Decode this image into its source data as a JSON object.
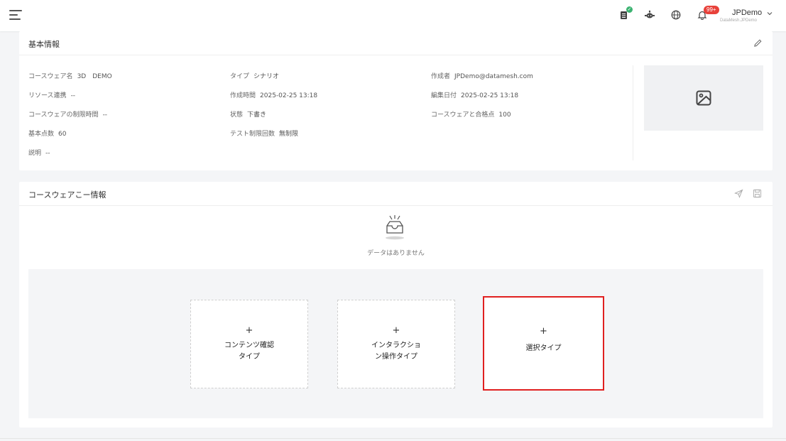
{
  "header": {
    "user_name": "JPDemo",
    "user_sub": "DataMesh.JPDemo",
    "notification_badge": "99+",
    "icons": [
      "menu-icon",
      "clipboard-check-icon",
      "robot-icon",
      "globe-icon",
      "bell-icon",
      "chevron-down-icon"
    ]
  },
  "basic_info": {
    "title": "基本情報",
    "fields": {
      "courseware_name": {
        "label": "コースウェア名",
        "value": "3D　DEMO"
      },
      "resource_link": {
        "label": "リソース連携",
        "value": "--"
      },
      "courseware_limit_time": {
        "label": "コースウェアの制限時間",
        "value": "--"
      },
      "base_score": {
        "label": "基本点数",
        "value": "60"
      },
      "description": {
        "label": "説明",
        "value": "--"
      },
      "type": {
        "label": "タイプ",
        "value": "シナリオ"
      },
      "created_time": {
        "label": "作成時間",
        "value": "2025-02-25 13:18"
      },
      "status": {
        "label": "状態",
        "value": "下書き"
      },
      "test_limit_count": {
        "label": "テスト制限回数",
        "value": "無制限"
      },
      "creator": {
        "label": "作成者",
        "value": "JPDemo@datamesh.com"
      },
      "edited_date": {
        "label": "編集日付",
        "value": "2025-02-25 13:18"
      },
      "pass_score": {
        "label": "コースウェアと合格点",
        "value": "100"
      }
    }
  },
  "courseware_info": {
    "title": "コースウェアこー情報",
    "empty_text": "データはありません",
    "types": [
      {
        "plus": "+",
        "label_line1": "コンテンツ確認",
        "label_line2": "タイプ",
        "selected": false
      },
      {
        "plus": "+",
        "label_line1": "インタラクショ",
        "label_line2": "ン操作タイプ",
        "selected": false
      },
      {
        "plus": "+",
        "label_line1": "選択タイプ",
        "label_line2": "",
        "selected": true
      }
    ]
  },
  "colors": {
    "selected_border": "#e02020",
    "badge": "#e8413a",
    "check": "#3cb371"
  }
}
